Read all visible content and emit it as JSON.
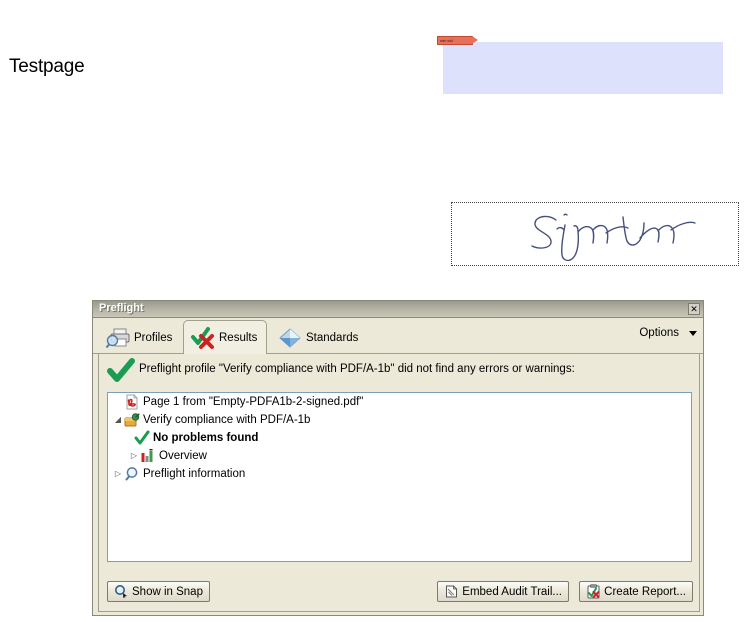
{
  "document": {
    "page_title": "Testpage",
    "annotation_tag_label": "wlm wkt",
    "signature_text": "Signatur"
  },
  "dialog": {
    "title": "Preflight",
    "close_label": "✕",
    "tabs": [
      {
        "label": "Profiles",
        "icon": "printer-magnifier-icon",
        "active": false
      },
      {
        "label": "Results",
        "icon": "check-cross-icon",
        "active": true
      },
      {
        "label": "Standards",
        "icon": "blue-diamond-icon",
        "active": false
      }
    ],
    "options_label": "Options",
    "summary": {
      "icon": "green-check-icon",
      "text": "Preflight profile \"Verify compliance with PDF/A-1b\" did not find any errors or warnings:"
    },
    "tree": [
      {
        "label": "Page 1 from \"Empty-PDFA1b-2-signed.pdf\"",
        "icon": "pdf-file-icon",
        "twisty": "",
        "indent": 4,
        "bold": false
      },
      {
        "label": "Verify compliance with PDF/A-1b",
        "icon": "profile-icon",
        "twisty": "◢",
        "indent": 4,
        "bold": false
      },
      {
        "label": "No problems found",
        "icon": "green-check-icon",
        "twisty": "",
        "indent": 26,
        "bold": true
      },
      {
        "label": "Overview",
        "icon": "bar-chart-icon",
        "twisty": "▷",
        "indent": 20,
        "bold": false
      },
      {
        "label": "Preflight information",
        "icon": "magnifier-icon",
        "twisty": "▷",
        "indent": 4,
        "bold": false
      }
    ],
    "buttons": {
      "show_in_snap": {
        "label": "Show in Snap",
        "icon": "magnifier-arrow-icon"
      },
      "embed_audit_trail": {
        "label": "Embed Audit Trail...",
        "icon": "pages-stack-icon"
      },
      "create_report": {
        "label": "Create Report...",
        "icon": "report-clipboard-icon"
      }
    }
  },
  "colors": {
    "annotation_fill": "#dde1fb",
    "annotation_tag": "#e8705a",
    "dialog_face": "#ece9d8",
    "success_green": "#1a9d52",
    "error_red": "#cc2222",
    "signature_ink": "#46507f"
  }
}
